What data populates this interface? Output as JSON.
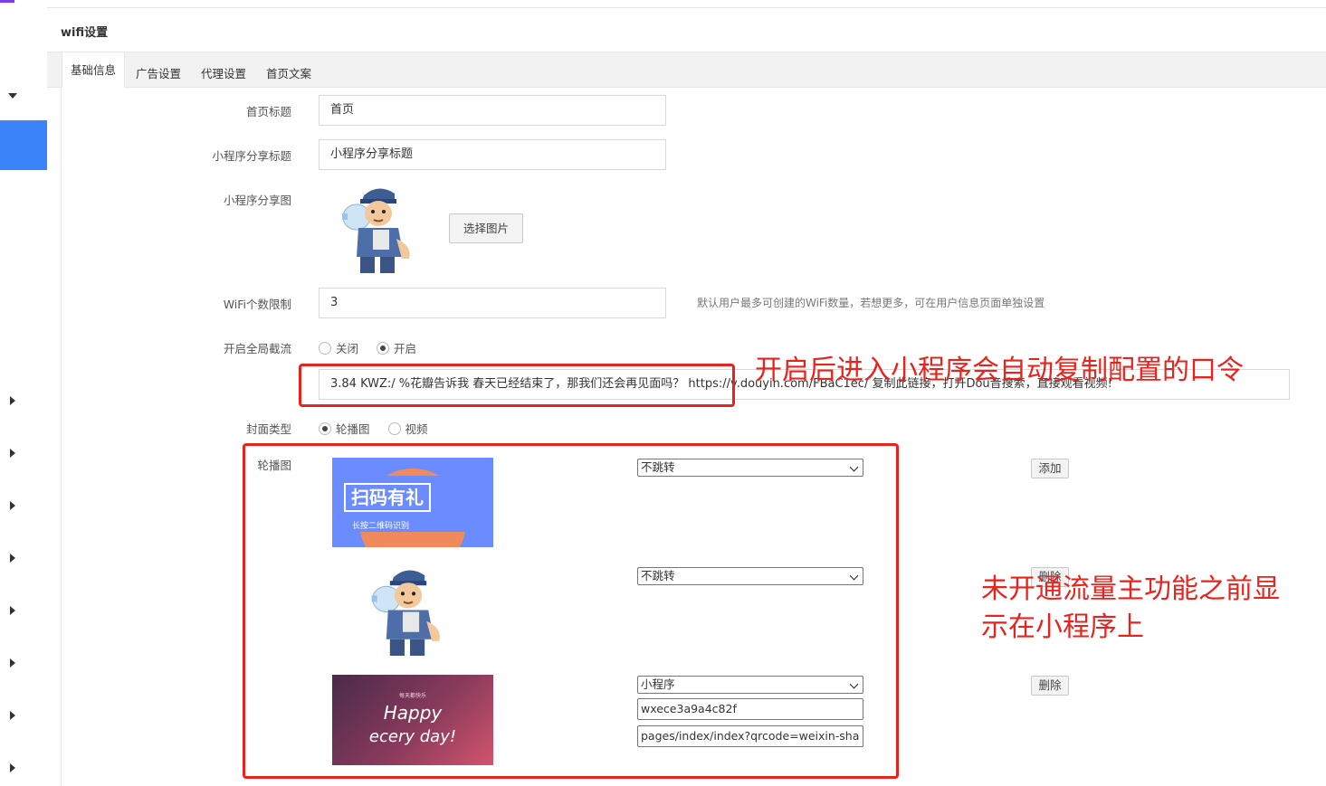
{
  "page": {
    "title": "wifi设置"
  },
  "tabs": [
    {
      "label": "基础信息",
      "active": true
    },
    {
      "label": "广告设置",
      "active": false
    },
    {
      "label": "代理设置",
      "active": false
    },
    {
      "label": "首页文案",
      "active": false
    }
  ],
  "form": {
    "home_title": {
      "label": "首页标题",
      "value": "首页"
    },
    "share_title": {
      "label": "小程序分享标题",
      "value": "小程序分享标题"
    },
    "share_image": {
      "label": "小程序分享图",
      "button": "选择图片"
    },
    "wifi_limit": {
      "label": "WiFi个数限制",
      "value": "3",
      "hint": "默认用户最多可创建的WiFi数量，若想更多，可在用户信息页面单独设置"
    },
    "global_intercept": {
      "label": "开启全局截流",
      "options": [
        {
          "label": "关闭",
          "checked": false
        },
        {
          "label": "开启",
          "checked": true
        }
      ],
      "command_value": "3.84 KWZ:/ %花瓣告诉我 春天已经结束了，那我们还会再见面吗？  https://v.douyin.com/FBaC1ec/ 复制此链接，打开Dou音搜索，直接观看视频!"
    },
    "cover_type": {
      "label": "封面类型",
      "options": [
        {
          "label": "轮播图",
          "checked": true
        },
        {
          "label": "视频",
          "checked": false
        }
      ]
    },
    "carousel": {
      "label": "轮播图",
      "add_button": "添加",
      "items": [
        {
          "image": "scan-gift-banner",
          "image_text": "扫码有礼",
          "image_subtext": "长按二维码识别",
          "jump": "不跳转"
        },
        {
          "image": "cartoon-worker",
          "jump": "不跳转",
          "delete": "删除"
        },
        {
          "image": "happy-everyday-card",
          "image_text_1": "Happy",
          "image_text_2": "ecery day!",
          "image_small": "每天都快乐",
          "jump": "小程序",
          "appid": "wxece3a9a4c82f",
          "path": "pages/index/index?qrcode=weixin-sha",
          "delete": "删除"
        }
      ]
    }
  },
  "annotations": {
    "command_note": "开启后进入小程序会自动复制配置的口令",
    "carousel_note_line1": "未开通流量主功能之前显",
    "carousel_note_line2": "示在小程序上",
    "color": "#e8231d"
  }
}
